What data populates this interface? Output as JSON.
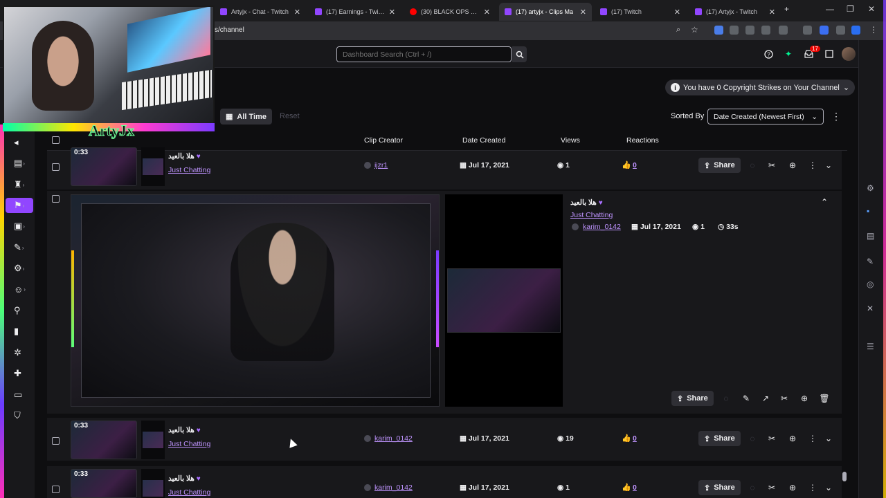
{
  "browser": {
    "tabs": [
      {
        "title": "Artyjx - Chat - Twitch",
        "icon": "twitch"
      },
      {
        "title": "(17) Earnings - Twitch",
        "icon": "twitch"
      },
      {
        "title": "(30) BLACK OPS 2 ZOMBIE",
        "icon": "youtube"
      },
      {
        "title": "(17) artyjx - Clips Ma",
        "icon": "twitch",
        "active": true
      },
      {
        "title": "(17) Twitch",
        "icon": "twitch"
      },
      {
        "title": "(17) Artyjx - Twitch",
        "icon": "twitch"
      }
    ],
    "new_tab": "+",
    "url": "s/channel"
  },
  "header": {
    "search_placeholder": "Dashboard Search (Ctrl + /)",
    "notification_count": "17"
  },
  "copyright": {
    "text": "You have 0 Copyright Strikes on Your Channel"
  },
  "filters": {
    "all_time": "All Time",
    "reset": "Reset",
    "sorted_by_label": "Sorted By",
    "sort_value": "Date Created (Newest First)"
  },
  "table": {
    "headers": [
      "Clip Creator",
      "Date Created",
      "Views",
      "Reactions"
    ],
    "rows": [
      {
        "duration": "0:33",
        "title": "هلا بالعيد",
        "category": "Just Chatting",
        "creator": "ijzr1",
        "date": "Jul 17, 2021",
        "views": "1",
        "reactions": "0",
        "share": "Share"
      },
      {
        "duration": "0:33",
        "title": "هلا بالعيد",
        "category": "Just Chatting",
        "creator": "karim_0142",
        "date": "Jul 17, 2021",
        "views": "19",
        "reactions": "0",
        "share": "Share"
      },
      {
        "duration": "0:33",
        "title": "هلا بالعيد",
        "category": "Just Chatting",
        "creator": "karim_0142",
        "date": "Jul 17, 2021",
        "views": "1",
        "reactions": "0",
        "share": "Share"
      }
    ]
  },
  "expanded": {
    "title": "هلا بالعيد",
    "category": "Just Chatting",
    "creator": "karim_0142",
    "date": "Jul 17, 2021",
    "views": "1",
    "duration": "33s",
    "share": "Share"
  },
  "overlay": {
    "logo": "ArtyJx"
  },
  "colors": {
    "accent": "#9146ff",
    "link": "#bf94ff",
    "background": "#0e0e10"
  }
}
